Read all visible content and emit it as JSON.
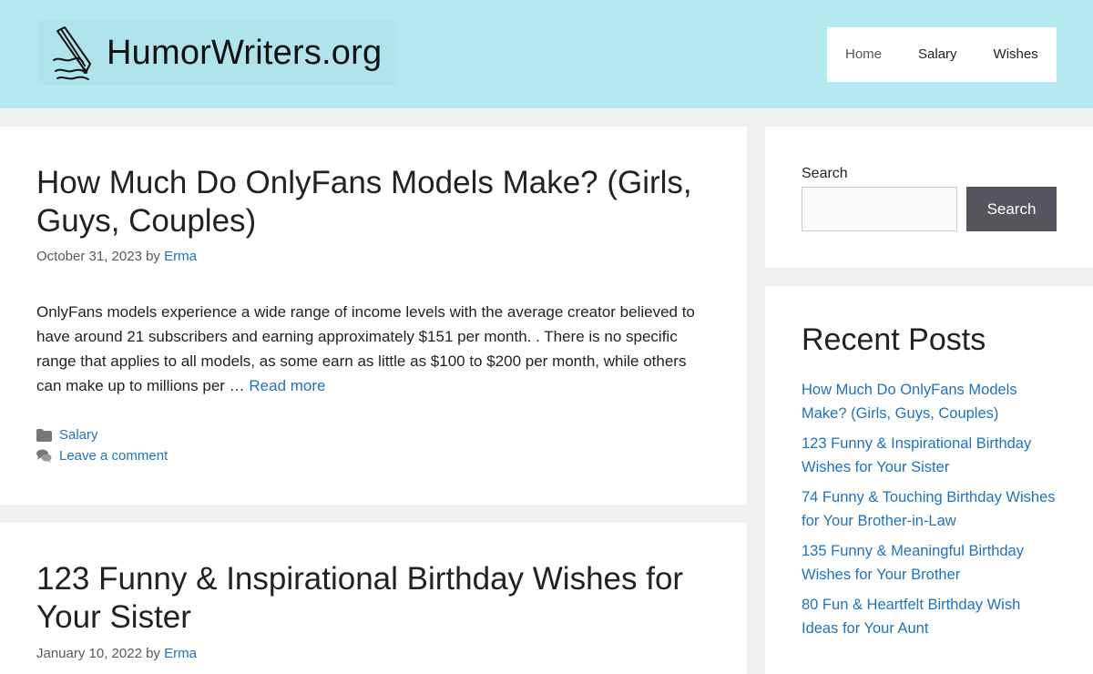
{
  "site": {
    "title": "HumorWriters.org",
    "logo_icon": "pen-writing-icon"
  },
  "nav": {
    "items": [
      {
        "label": "Home"
      },
      {
        "label": "Salary"
      },
      {
        "label": "Wishes"
      }
    ]
  },
  "posts": [
    {
      "title": "How Much Do OnlyFans Models Make? (Girls, Guys, Couples)",
      "date": "October 31, 2023",
      "by": "by",
      "author": "Erma",
      "excerpt": "OnlyFans models experience a wide range of income levels with the average creator believed to have around 21 subscribers and earning approximately $151 per month. . There is no specific range that applies to all models, as some earn as little as $100 to $200 per month, while others can make up to millions per …",
      "read_more": "Read more",
      "category": "Salary",
      "comment_link": "Leave a comment",
      "category_icon": "folder-icon",
      "comment_icon": "comments-icon"
    },
    {
      "title": "123 Funny & Inspirational Birthday Wishes for Your Sister",
      "date": "January 10, 2022",
      "by": "by",
      "author": "Erma"
    }
  ],
  "search": {
    "label": "Search",
    "value": "",
    "placeholder": "",
    "button_label": "Search"
  },
  "recent_posts": {
    "title": "Recent Posts",
    "items": [
      "How Much Do OnlyFans Models Make? (Girls, Guys, Couples)",
      "123 Funny & Inspirational Birthday Wishes for Your Sister",
      "74 Funny & Touching Birthday Wishes for Your Brother-in-Law",
      "135 Funny & Meaningful Birthday Wishes for Your Brother",
      "80 Fun & Heartfelt Birthday Wish Ideas for Your Aunt"
    ]
  },
  "colors": {
    "header_bg": "#b4e9f0",
    "link": "#1e73be",
    "button_bg": "#55555e",
    "page_bg": "#eff0f1"
  }
}
